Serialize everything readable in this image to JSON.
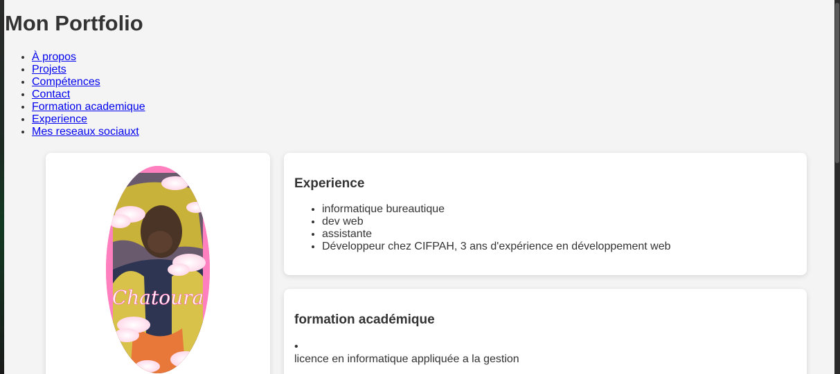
{
  "header": {
    "title": "Mon Portfolio"
  },
  "nav": {
    "items": [
      {
        "label": "À propos"
      },
      {
        "label": "Projets"
      },
      {
        "label": "Compétences"
      },
      {
        "label": "Contact"
      },
      {
        "label": "Formation academique"
      },
      {
        "label": "Experience"
      },
      {
        "label": "Mes reseaux sociauxt"
      }
    ]
  },
  "profile": {
    "photo_caption": "Chatoura",
    "frame_color": "#ff7fbf"
  },
  "experience": {
    "title": "Experience",
    "items": [
      "informatique bureautique",
      "dev web",
      "assistante",
      "Développeur chez CIFPAH, 3 ans d'expérience en développement web"
    ]
  },
  "formation": {
    "title": "formation académique",
    "bullet": "•",
    "text": "licence en informatique appliquée a la gestion"
  },
  "colors": {
    "page_background": "#f4f4f4",
    "card_background": "#ffffff",
    "link": "#0000ee",
    "text": "#333333"
  }
}
